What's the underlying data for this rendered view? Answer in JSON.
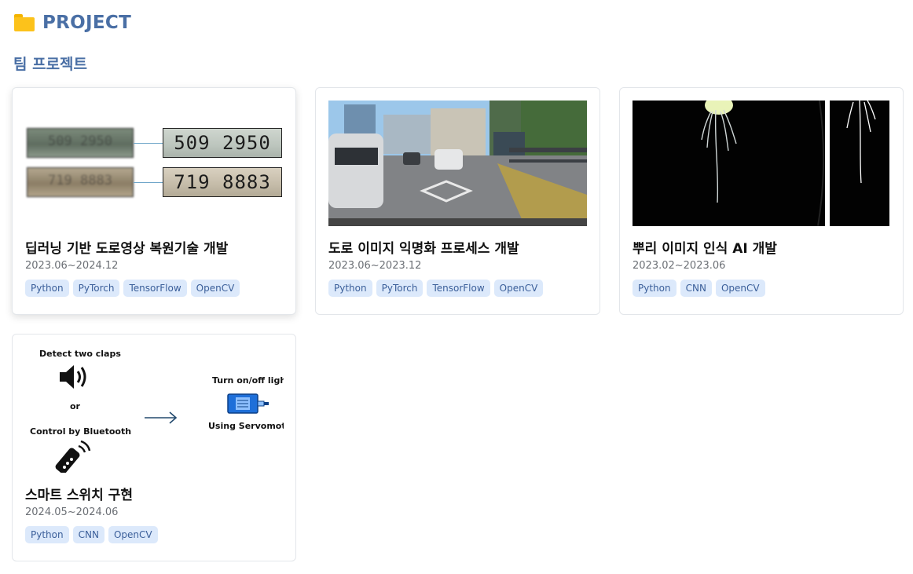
{
  "header": {
    "title": "PROJECT",
    "icon": "folder-icon"
  },
  "section": {
    "title": "팀 프로젝트"
  },
  "colors": {
    "accent": "#4a6fa5",
    "tag_bg": "#dce9fb",
    "tag_text": "#3b5f9a"
  },
  "projects": [
    {
      "title": "딥러닝 기반 도로영상 복원기술 개발",
      "date": "2023.06~2024.12",
      "tags": [
        "Python",
        "PyTorch",
        "TensorFlow",
        "OpenCV"
      ],
      "media": {
        "plate_top": "509 2950",
        "plate_bottom": "719 8883"
      }
    },
    {
      "title": "도로 이미지 익명화 프로세스 개발",
      "date": "2023.06~2023.12",
      "tags": [
        "Python",
        "PyTorch",
        "TensorFlow",
        "OpenCV"
      ]
    },
    {
      "title": "뿌리 이미지 인식 AI 개발",
      "date": "2023.02~2023.06",
      "tags": [
        "Python",
        "CNN",
        "OpenCV"
      ]
    },
    {
      "title": "스마트 스위치 구현",
      "date": "2024.05~2024.06",
      "tags": [
        "Python",
        "CNN",
        "OpenCV"
      ],
      "media": {
        "detect": "Detect two claps",
        "or": "or",
        "bluetooth": "Control by Bluetooth",
        "turn": "Turn on/off lights",
        "servo": "Using Servomotor"
      }
    }
  ]
}
